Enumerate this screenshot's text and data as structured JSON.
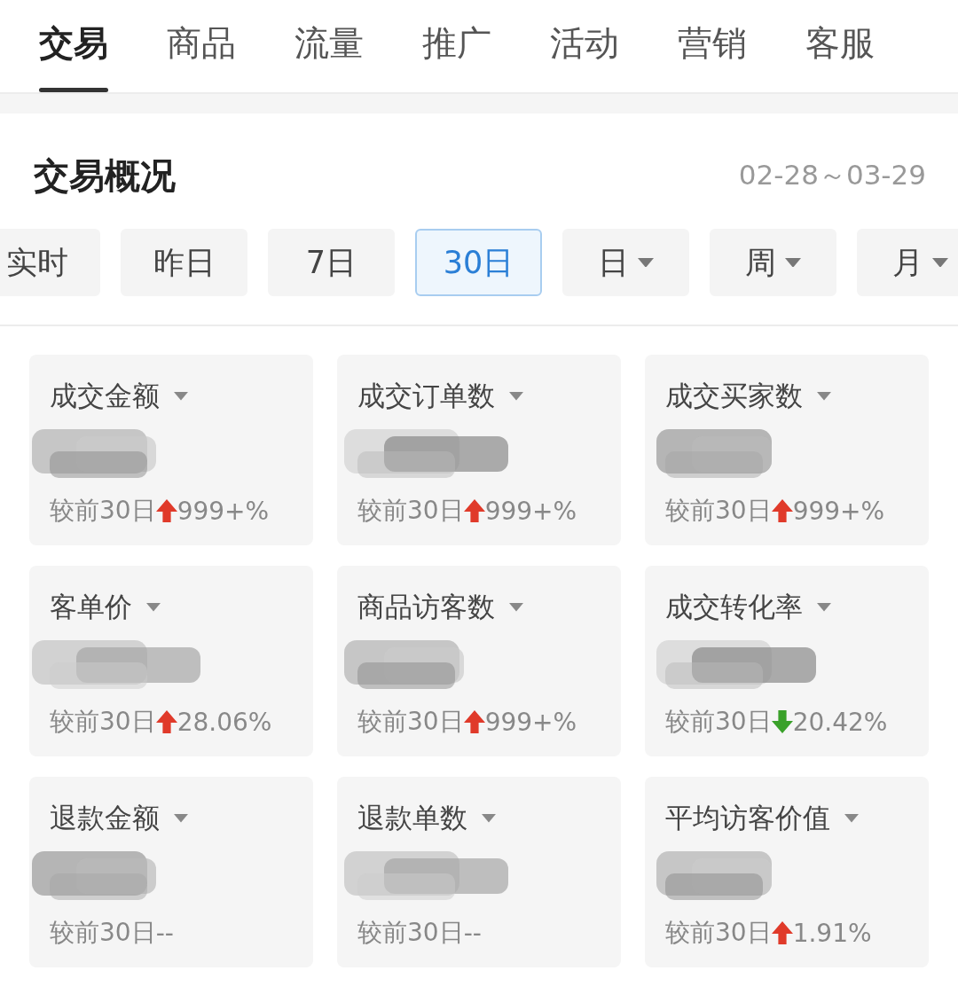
{
  "tabs": [
    {
      "label": "交易",
      "selected": true
    },
    {
      "label": "商品",
      "selected": false
    },
    {
      "label": "流量",
      "selected": false
    },
    {
      "label": "推广",
      "selected": false
    },
    {
      "label": "活动",
      "selected": false
    },
    {
      "label": "营销",
      "selected": false
    },
    {
      "label": "客服",
      "selected": false
    }
  ],
  "overview": {
    "title": "交易概况",
    "date_range": "02-28～03-29",
    "periods": [
      {
        "label": "实时",
        "kind": "plain",
        "selected": false
      },
      {
        "label": "昨日",
        "kind": "plain",
        "selected": false
      },
      {
        "label": "7日",
        "kind": "plain",
        "selected": false
      },
      {
        "label": "30日",
        "kind": "plain",
        "selected": true
      },
      {
        "label": "日",
        "kind": "dropdown",
        "selected": false
      },
      {
        "label": "周",
        "kind": "dropdown",
        "selected": false
      },
      {
        "label": "月",
        "kind": "dropdown",
        "selected": false
      }
    ],
    "metrics": [
      {
        "name": "成交金额",
        "compare": "较前30日",
        "kind": "up",
        "change": "999+%"
      },
      {
        "name": "成交订单数",
        "compare": "较前30日",
        "kind": "up",
        "change": "999+%"
      },
      {
        "name": "成交买家数",
        "compare": "较前30日",
        "kind": "up",
        "change": "999+%"
      },
      {
        "name": "客单价",
        "compare": "较前30日",
        "kind": "up",
        "change": "28.06%"
      },
      {
        "name": "商品访客数",
        "compare": "较前30日",
        "kind": "up",
        "change": "999+%"
      },
      {
        "name": "成交转化率",
        "compare": "较前30日",
        "kind": "down",
        "change": "20.42%"
      },
      {
        "name": "退款金额",
        "compare": "较前30日",
        "kind": "flat",
        "change": "--"
      },
      {
        "name": "退款单数",
        "compare": "较前30日",
        "kind": "flat",
        "change": "--"
      },
      {
        "name": "平均访客价值",
        "compare": "较前30日",
        "kind": "up",
        "change": "1.91%"
      }
    ]
  }
}
